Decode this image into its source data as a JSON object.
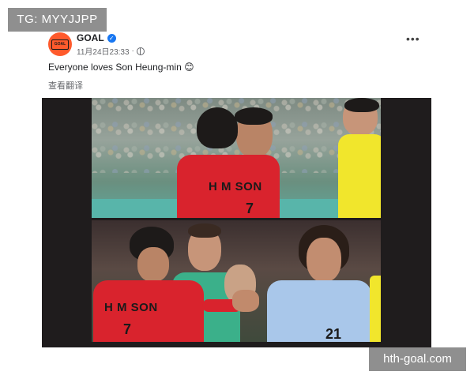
{
  "watermarks": {
    "top_left": "TG: MYYJJPP",
    "bottom_right": "hth-goal.com"
  },
  "post": {
    "author": {
      "name": "GOAL",
      "avatar_text": "GOAL",
      "verified": true,
      "avatar_color": "#ff5a2c"
    },
    "timestamp": "11月24日23:33",
    "separator": "·",
    "audience_icon": "globe-icon",
    "more_options": "•••",
    "caption": "Everyone loves Son Heung-min 😊",
    "translate_link": "查看翻译",
    "media": {
      "top_photo": {
        "jersey_name": "H M SON",
        "jersey_number": "7"
      },
      "bottom_photo": {
        "jersey_name": "H M SON",
        "jersey_number": "7",
        "other_number": "21"
      }
    }
  },
  "colors": {
    "verified": "#1877f2",
    "korea_red": "#d9232d",
    "referee_yellow": "#f1e62c",
    "uruguay_blue": "#a9c7ea",
    "keeper_green": "#3bb08a"
  }
}
